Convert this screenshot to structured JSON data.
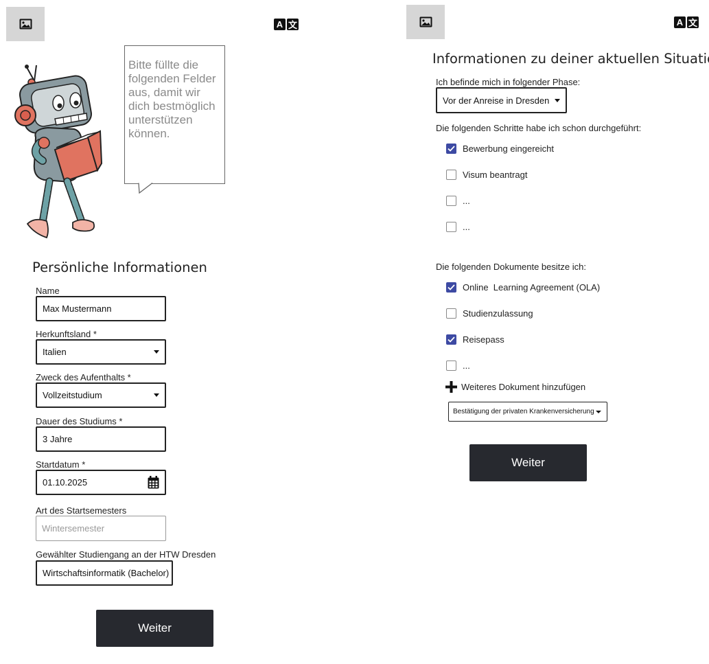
{
  "colors": {
    "button_bg": "#27292f",
    "checkbox_checked": "#3d4aa3",
    "placeholder_tile": "#d6d6d6",
    "bubble_text": "#8a8a8a"
  },
  "left": {
    "image_icon": "image-icon",
    "translate_icon": "translate-icon",
    "speech_bubble": "Bitte füllte die folgenden Felder aus, damit wir dich bestmöglich unterstützen können.",
    "section_title": "Persönliche Informationen",
    "fields": {
      "name": {
        "label": "Name",
        "value": "Max Mustermann"
      },
      "country": {
        "label": "Herkunftsland *",
        "value": "Italien"
      },
      "purpose": {
        "label": "Zweck des Aufenthalts *",
        "value": "Vollzeitstudium"
      },
      "duration": {
        "label": "Dauer des Studiums *",
        "value": "3 Jahre"
      },
      "start_date": {
        "label": "Startdatum *",
        "value": "01.10.2025"
      },
      "semester": {
        "label": "Art des Startsemesters",
        "placeholder": "Wintersemester"
      },
      "program": {
        "label": "Gewählter Studiengang an der HTW Dresden",
        "value": "Wirtschaftsinformatik (Bachelor)"
      }
    },
    "next_button": "Weiter"
  },
  "right": {
    "image_icon": "image-icon",
    "translate_icon": "translate-icon",
    "section_title": "Informationen zu deiner aktuellen Situation",
    "phase": {
      "label": "Ich befinde mich in folgender Phase:",
      "value": "Vor der Anreise in Dresden"
    },
    "steps": {
      "heading": "Die folgenden Schritte habe ich schon durchgeführt:",
      "items": [
        {
          "label": "Bewerbung eingereicht",
          "checked": true
        },
        {
          "label": "Visum beantragt",
          "checked": false
        },
        {
          "label": "...",
          "checked": false
        },
        {
          "label": "...",
          "checked": false
        }
      ]
    },
    "documents": {
      "heading": "Die folgenden Dokumente besitze ich:",
      "items": [
        {
          "label": "Online  Learning Agreement (OLA)",
          "checked": true
        },
        {
          "label": "Studienzulassung",
          "checked": false
        },
        {
          "label": "Reisepass",
          "checked": true
        },
        {
          "label": "...",
          "checked": false
        }
      ]
    },
    "add_document": "Weiteres Dokument hinzufügen",
    "document_select": "Bestätigung der privaten Krankenversicherung",
    "next_button": "Weiter"
  }
}
